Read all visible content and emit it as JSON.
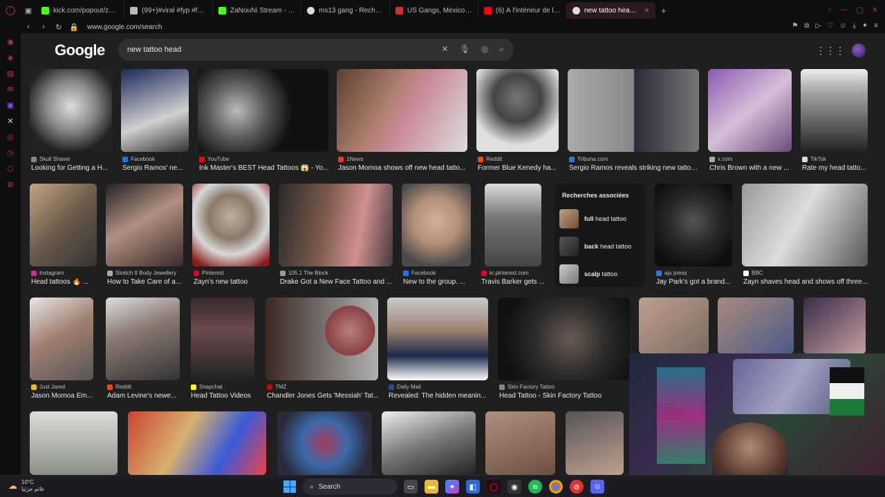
{
  "browser": {
    "tabs": [
      {
        "label": "kick.com/popout/zanouni",
        "color": "#53fc18"
      },
      {
        "label": "(99+)#viral #fyp #foryou",
        "color": "#bbb"
      },
      {
        "label": "ZaNouNi Stream - Watch",
        "color": "#53fc18"
      },
      {
        "label": "ms13 gang - Recherche G",
        "color": "#ddd"
      },
      {
        "label": "US Gangs, Mexico Cartel",
        "color": "#c33"
      },
      {
        "label": "(6) À l'intérieur de la priso",
        "color": "#f00"
      },
      {
        "label": "new tattoo head - Recherc",
        "color": "#ddd"
      }
    ],
    "url": "www.google.com/search"
  },
  "google": {
    "logo": "Google",
    "query": "new tattoo head"
  },
  "row1": [
    {
      "source": "Skull Shaver",
      "title": "Looking for Getting a H...",
      "src_color": "#888"
    },
    {
      "source": "Facebook",
      "title": "Sergio Ramos' ne...",
      "src_color": "#1877f2"
    },
    {
      "source": "YouTube",
      "title": "Ink Master's BEST Head Tattoos 😱 - Yo...",
      "src_color": "#f00"
    },
    {
      "source": "1News",
      "title": "Jason Momoa shows off new head tatto...",
      "src_color": "#e33"
    },
    {
      "source": "Reddit",
      "title": "Former Blue Kenedy ha...",
      "src_color": "#ff4500"
    },
    {
      "source": "Tribuna.com",
      "title": "Sergio Ramos reveals striking new tattoo...",
      "src_color": "#2a7ad8"
    },
    {
      "source": "x.com",
      "title": "Chris Brown with a new ...",
      "src_color": "#aaa"
    },
    {
      "source": "TikTok",
      "title": "Rate my head tatto...",
      "src_color": "#ddd"
    }
  ],
  "row2": [
    {
      "source": "Instagram",
      "title": "Head tattoos 🔥 ...",
      "src_color": "#d6249f"
    },
    {
      "source": "Stretch It Body Jewellery",
      "title": "How to Take Care of a...",
      "src_color": "#aaa"
    },
    {
      "source": "Pinterest",
      "title": "Zayn's new tattoo",
      "src_color": "#e60023"
    },
    {
      "source": "105.1 The Block",
      "title": "Drake Got a New Face Tattoo and ...",
      "src_color": "#999"
    },
    {
      "source": "Facebook",
      "title": "New to the group. ...",
      "src_color": "#1877f2"
    },
    {
      "source": "kr.pinterest.com",
      "title": "Travis Barker gets ...",
      "src_color": "#e60023"
    },
    {
      "source": "aju press",
      "title": "Jay Park's got a brand...",
      "src_color": "#2a7ad8"
    },
    {
      "source": "BBC",
      "title": "Zayn shaves head and shows off three...",
      "src_color": "#fff"
    }
  ],
  "related": {
    "title": "Recherches associées",
    "items": [
      {
        "bold": "full",
        "rest": " head tattoo"
      },
      {
        "bold": "back",
        "rest": " head tattoo"
      },
      {
        "bold": "scalp",
        "rest": " tattoo"
      }
    ]
  },
  "row3": [
    {
      "source": "Just Jared",
      "title": "Jason Momoa Em...",
      "src_color": "#e8c400"
    },
    {
      "source": "Reddit",
      "title": "Adam Levine's newe...",
      "src_color": "#ff4500"
    },
    {
      "source": "Snapchat",
      "title": "Head Tattoo Videos",
      "src_color": "#fffc00"
    },
    {
      "source": "TMZ",
      "title": "Chandler Jones Gets 'Messiah' Tat...",
      "src_color": "#c00"
    },
    {
      "source": "Daily Mail",
      "title": "Revealed: The hidden meanin...",
      "src_color": "#2a4a8a"
    },
    {
      "source": "Skin Factory Tattoo",
      "title": "Head Tattoo - Skin Factory Tattoo",
      "src_color": "#888"
    }
  ],
  "taskbar": {
    "temp": "10°C",
    "weather_desc": "غائم جزئيا",
    "search_label": "Search"
  }
}
